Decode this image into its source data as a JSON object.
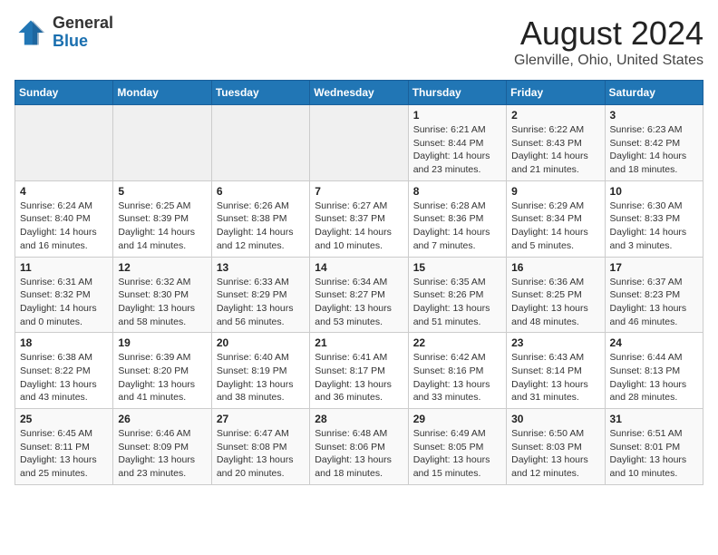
{
  "header": {
    "logo_general": "General",
    "logo_blue": "Blue",
    "title": "August 2024",
    "subtitle": "Glenville, Ohio, United States"
  },
  "weekdays": [
    "Sunday",
    "Monday",
    "Tuesday",
    "Wednesday",
    "Thursday",
    "Friday",
    "Saturday"
  ],
  "weeks": [
    [
      {
        "day": "",
        "info": ""
      },
      {
        "day": "",
        "info": ""
      },
      {
        "day": "",
        "info": ""
      },
      {
        "day": "",
        "info": ""
      },
      {
        "day": "1",
        "info": "Sunrise: 6:21 AM\nSunset: 8:44 PM\nDaylight: 14 hours\nand 23 minutes."
      },
      {
        "day": "2",
        "info": "Sunrise: 6:22 AM\nSunset: 8:43 PM\nDaylight: 14 hours\nand 21 minutes."
      },
      {
        "day": "3",
        "info": "Sunrise: 6:23 AM\nSunset: 8:42 PM\nDaylight: 14 hours\nand 18 minutes."
      }
    ],
    [
      {
        "day": "4",
        "info": "Sunrise: 6:24 AM\nSunset: 8:40 PM\nDaylight: 14 hours\nand 16 minutes."
      },
      {
        "day": "5",
        "info": "Sunrise: 6:25 AM\nSunset: 8:39 PM\nDaylight: 14 hours\nand 14 minutes."
      },
      {
        "day": "6",
        "info": "Sunrise: 6:26 AM\nSunset: 8:38 PM\nDaylight: 14 hours\nand 12 minutes."
      },
      {
        "day": "7",
        "info": "Sunrise: 6:27 AM\nSunset: 8:37 PM\nDaylight: 14 hours\nand 10 minutes."
      },
      {
        "day": "8",
        "info": "Sunrise: 6:28 AM\nSunset: 8:36 PM\nDaylight: 14 hours\nand 7 minutes."
      },
      {
        "day": "9",
        "info": "Sunrise: 6:29 AM\nSunset: 8:34 PM\nDaylight: 14 hours\nand 5 minutes."
      },
      {
        "day": "10",
        "info": "Sunrise: 6:30 AM\nSunset: 8:33 PM\nDaylight: 14 hours\nand 3 minutes."
      }
    ],
    [
      {
        "day": "11",
        "info": "Sunrise: 6:31 AM\nSunset: 8:32 PM\nDaylight: 14 hours\nand 0 minutes."
      },
      {
        "day": "12",
        "info": "Sunrise: 6:32 AM\nSunset: 8:30 PM\nDaylight: 13 hours\nand 58 minutes."
      },
      {
        "day": "13",
        "info": "Sunrise: 6:33 AM\nSunset: 8:29 PM\nDaylight: 13 hours\nand 56 minutes."
      },
      {
        "day": "14",
        "info": "Sunrise: 6:34 AM\nSunset: 8:27 PM\nDaylight: 13 hours\nand 53 minutes."
      },
      {
        "day": "15",
        "info": "Sunrise: 6:35 AM\nSunset: 8:26 PM\nDaylight: 13 hours\nand 51 minutes."
      },
      {
        "day": "16",
        "info": "Sunrise: 6:36 AM\nSunset: 8:25 PM\nDaylight: 13 hours\nand 48 minutes."
      },
      {
        "day": "17",
        "info": "Sunrise: 6:37 AM\nSunset: 8:23 PM\nDaylight: 13 hours\nand 46 minutes."
      }
    ],
    [
      {
        "day": "18",
        "info": "Sunrise: 6:38 AM\nSunset: 8:22 PM\nDaylight: 13 hours\nand 43 minutes."
      },
      {
        "day": "19",
        "info": "Sunrise: 6:39 AM\nSunset: 8:20 PM\nDaylight: 13 hours\nand 41 minutes."
      },
      {
        "day": "20",
        "info": "Sunrise: 6:40 AM\nSunset: 8:19 PM\nDaylight: 13 hours\nand 38 minutes."
      },
      {
        "day": "21",
        "info": "Sunrise: 6:41 AM\nSunset: 8:17 PM\nDaylight: 13 hours\nand 36 minutes."
      },
      {
        "day": "22",
        "info": "Sunrise: 6:42 AM\nSunset: 8:16 PM\nDaylight: 13 hours\nand 33 minutes."
      },
      {
        "day": "23",
        "info": "Sunrise: 6:43 AM\nSunset: 8:14 PM\nDaylight: 13 hours\nand 31 minutes."
      },
      {
        "day": "24",
        "info": "Sunrise: 6:44 AM\nSunset: 8:13 PM\nDaylight: 13 hours\nand 28 minutes."
      }
    ],
    [
      {
        "day": "25",
        "info": "Sunrise: 6:45 AM\nSunset: 8:11 PM\nDaylight: 13 hours\nand 25 minutes."
      },
      {
        "day": "26",
        "info": "Sunrise: 6:46 AM\nSunset: 8:09 PM\nDaylight: 13 hours\nand 23 minutes."
      },
      {
        "day": "27",
        "info": "Sunrise: 6:47 AM\nSunset: 8:08 PM\nDaylight: 13 hours\nand 20 minutes."
      },
      {
        "day": "28",
        "info": "Sunrise: 6:48 AM\nSunset: 8:06 PM\nDaylight: 13 hours\nand 18 minutes."
      },
      {
        "day": "29",
        "info": "Sunrise: 6:49 AM\nSunset: 8:05 PM\nDaylight: 13 hours\nand 15 minutes."
      },
      {
        "day": "30",
        "info": "Sunrise: 6:50 AM\nSunset: 8:03 PM\nDaylight: 13 hours\nand 12 minutes."
      },
      {
        "day": "31",
        "info": "Sunrise: 6:51 AM\nSunset: 8:01 PM\nDaylight: 13 hours\nand 10 minutes."
      }
    ]
  ]
}
